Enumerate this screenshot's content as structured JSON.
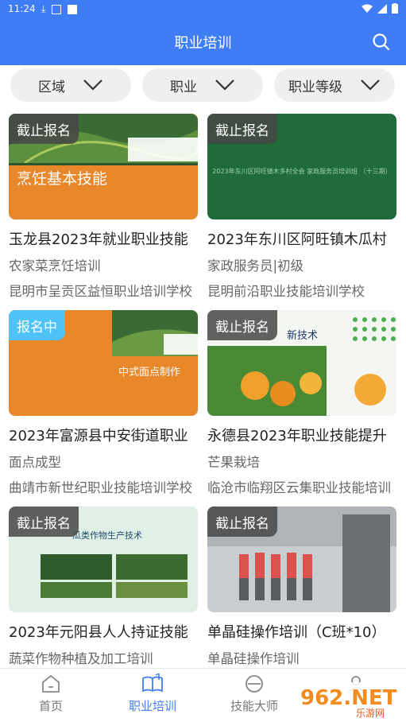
{
  "status_bar": {
    "time": "11:24"
  },
  "header": {
    "title": "职业培训"
  },
  "filters": [
    {
      "label": "区域"
    },
    {
      "label": "职业"
    },
    {
      "label": "职业等级"
    }
  ],
  "cards": [
    {
      "badge": "截止报名",
      "badge_type": "closed",
      "title": "玉龙县2023年就业职业技能",
      "subtitle": "农家菜烹饪培训",
      "org": "昆明市呈贡区益恒职业培训学校",
      "thumb_text": "烹饪基本技能"
    },
    {
      "badge": "截止报名",
      "badge_type": "closed",
      "title": "2023年东川区阿旺镇木瓜村",
      "subtitle": "家政服务员|初级",
      "org": "昆明前沿职业技能培训学校",
      "thumb_text": "2023年东川区阿旺镇木多村全会 家政服务员培训班 （十三期）"
    },
    {
      "badge": "报名中",
      "badge_type": "open",
      "title": "2023年富源县中安街道职业",
      "subtitle": "面点成型",
      "org": "曲靖市新世纪职业技能培训学校",
      "thumb_text": "中式面点制作"
    },
    {
      "badge": "截止报名",
      "badge_type": "closed",
      "title": "永德县2023年职业技能提升",
      "subtitle": "芒果栽培",
      "org": "临沧市临翔区云集职业技能培训",
      "thumb_text": "新技术"
    },
    {
      "badge": "截止报名",
      "badge_type": "closed",
      "title": "2023年元阳县人人持证技能",
      "subtitle": "蔬菜作物种植及加工培训",
      "org": "",
      "thumb_text": "瓜类作物生产技术"
    },
    {
      "badge": "截止报名",
      "badge_type": "closed",
      "title": "单晶硅操作培训（C班*10）",
      "subtitle": "单晶硅操作培训",
      "org": "",
      "thumb_text": ""
    }
  ],
  "tabs": [
    {
      "label": "首页",
      "icon": "home-icon",
      "active": false
    },
    {
      "label": "职业培训",
      "icon": "book-icon",
      "active": true
    },
    {
      "label": "技能大师",
      "icon": "master-icon",
      "active": false
    },
    {
      "label": "",
      "icon": "profile-icon",
      "active": false
    }
  ],
  "watermark": {
    "text": "962.NET",
    "subtext": "乐游网"
  },
  "colors": {
    "primary": "#3f7df6",
    "badge_closed": "#464646",
    "badge_open": "#4fc3f7"
  }
}
